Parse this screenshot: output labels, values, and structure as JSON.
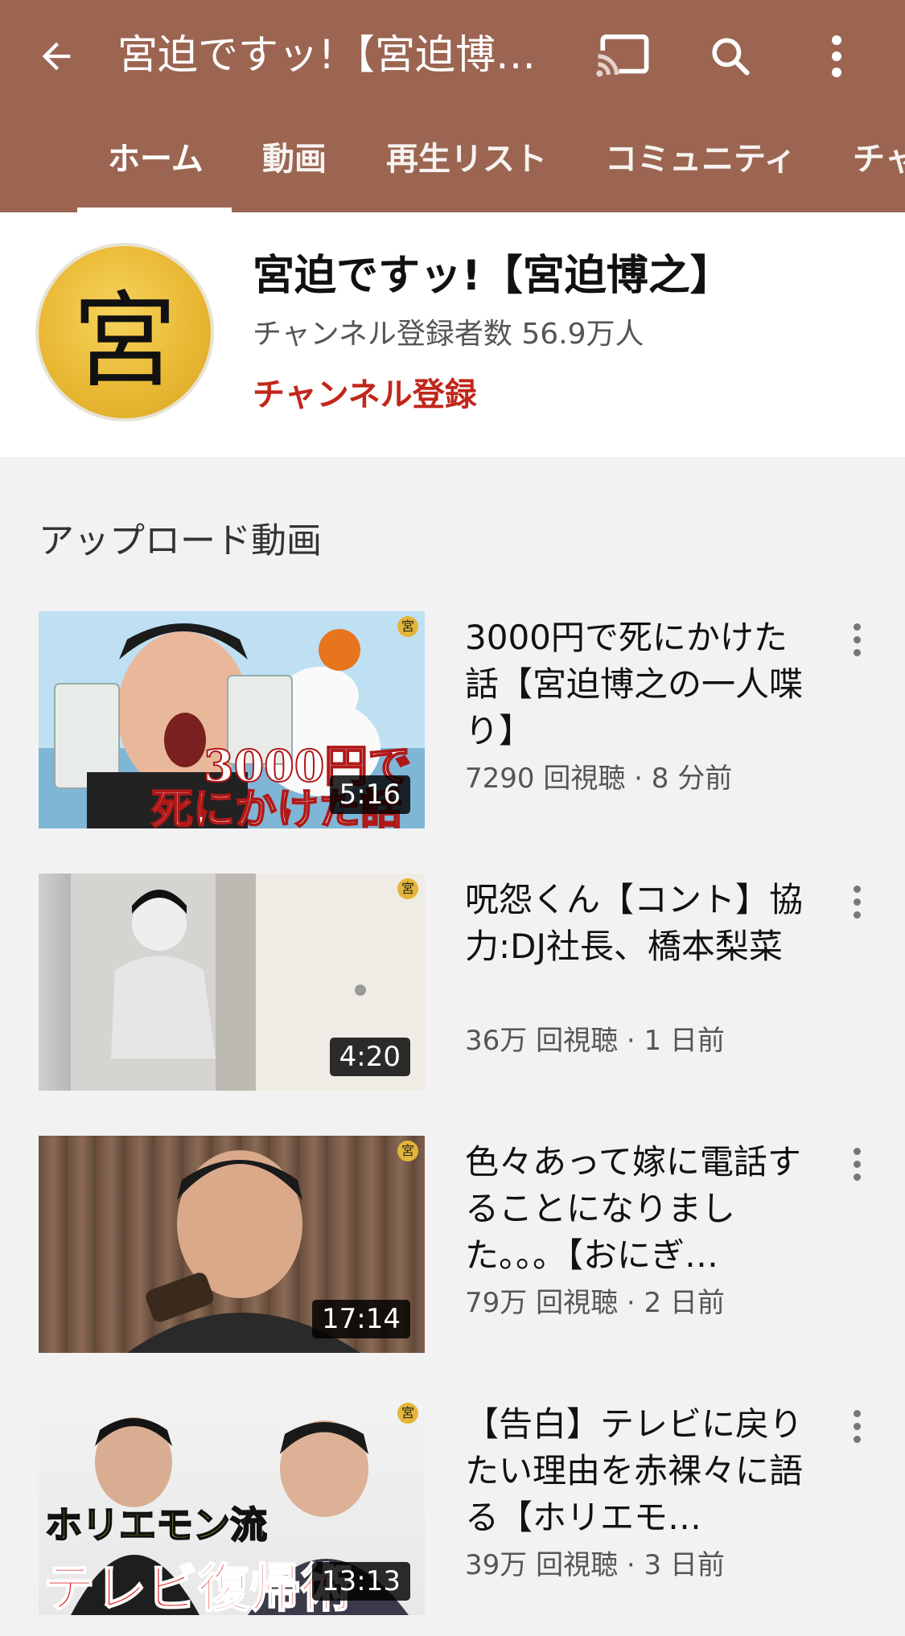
{
  "appbar": {
    "title": "宮迫ですッ!【宮迫博…",
    "back_icon": "arrow-back-icon",
    "cast_icon": "cast-icon",
    "search_icon": "search-icon",
    "more_icon": "more-vert-icon"
  },
  "tabs": [
    {
      "label": "ホーム",
      "active": true
    },
    {
      "label": "動画"
    },
    {
      "label": "再生リスト"
    },
    {
      "label": "コミュニティ"
    },
    {
      "label": "チャ"
    }
  ],
  "channel": {
    "avatar_char": "宮",
    "name": "宮迫ですッ!【宮迫博之】",
    "subscribers": "チャンネル登録者数 56.9万人",
    "subscribe_label": "チャンネル登録"
  },
  "section_title": "アップロード動画",
  "videos": [
    {
      "title": "3000円で死にかけた話【宮迫博之の一人喋り】",
      "meta": "7290 回視聴 · 8 分前",
      "duration": "5:16",
      "thumb_caption_1": "3000円で",
      "thumb_caption_2": "死にかけた話"
    },
    {
      "title": "呪怨くん【コント】協力:DJ社長、橋本梨菜",
      "meta": "36万 回視聴 · 1 日前",
      "duration": "4:20"
    },
    {
      "title": "色々あって嫁に電話することになりました。。。【おにぎ…",
      "meta": "79万 回視聴 · 2 日前",
      "duration": "17:14"
    },
    {
      "title": "【告白】テレビに戻りたい理由を赤裸々に語る【ホリエモ…",
      "meta": "39万 回視聴 · 3 日前",
      "duration": "13:13",
      "thumb_caption_1": "ホリエモン流",
      "thumb_caption_2": "テレビ復帰術"
    }
  ],
  "thumb_badge_char": "宮",
  "colors": {
    "appbar": "#9b6552",
    "subscribe": "#c1271b",
    "background": "#f2f2f2"
  }
}
